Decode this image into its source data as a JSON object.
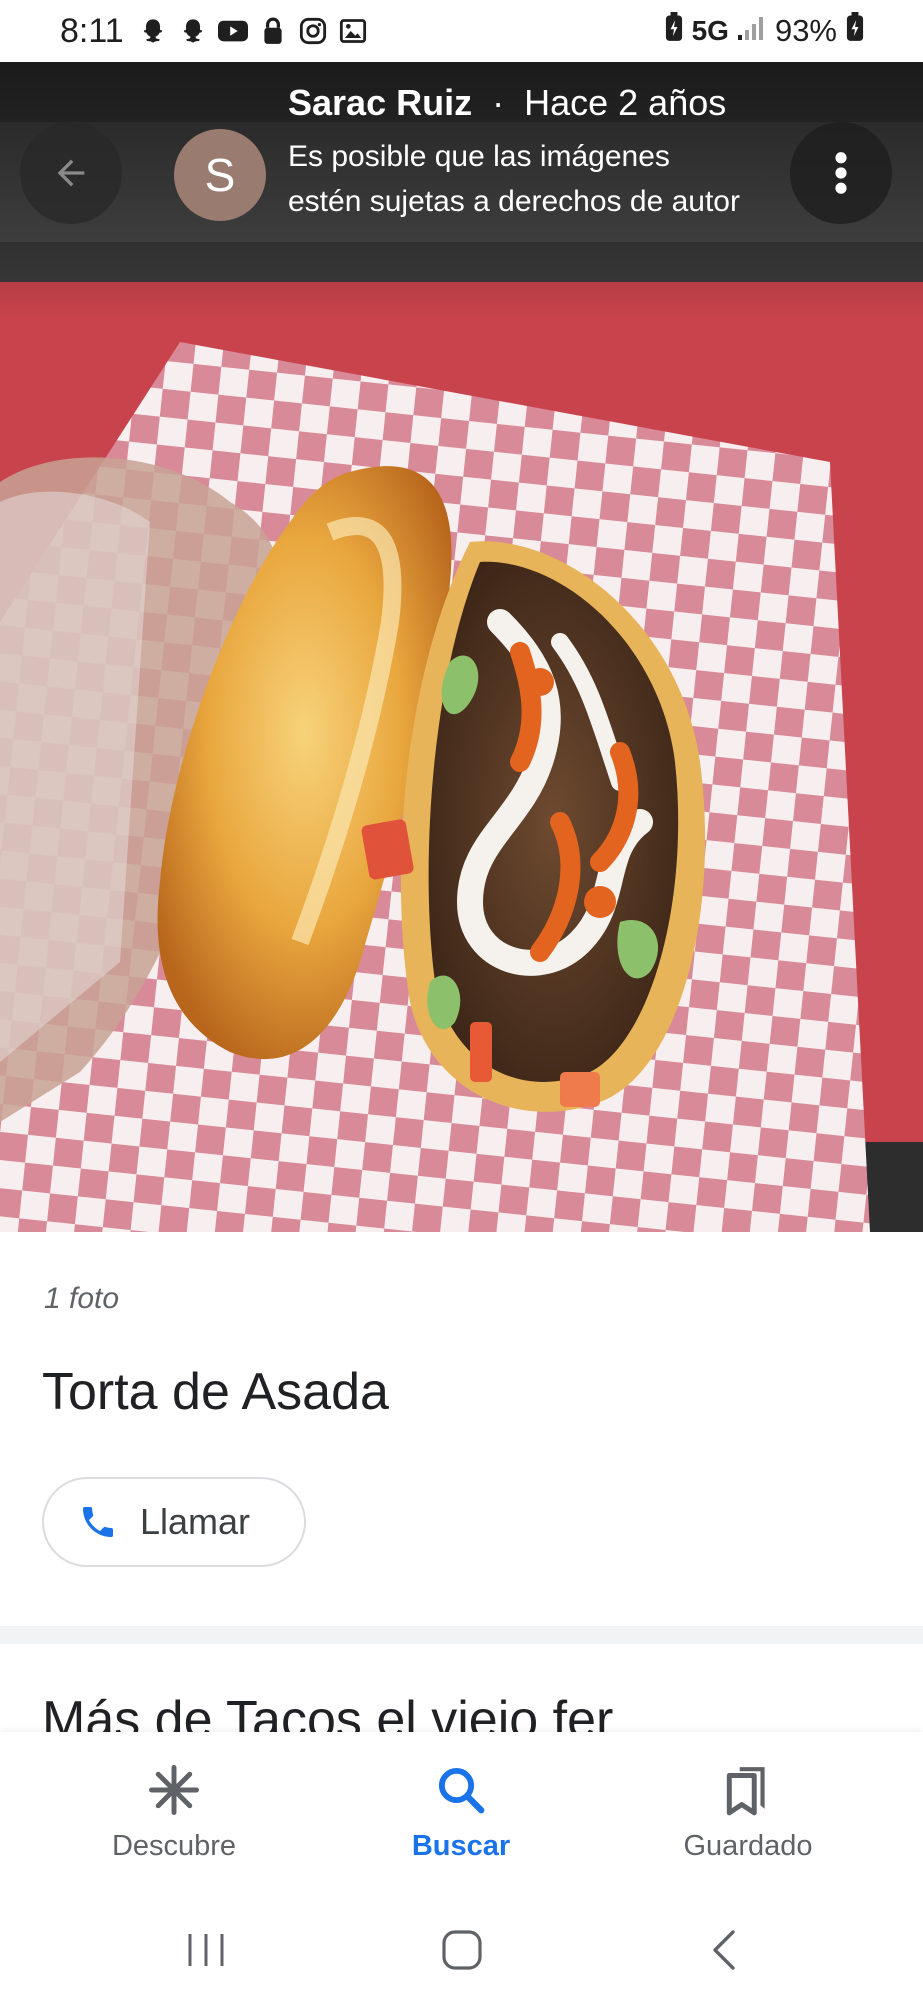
{
  "status_bar": {
    "time": "8:11",
    "network": "5G",
    "battery": "93%",
    "left_icons": [
      "snapchat-icon",
      "snapchat-icon",
      "youtube-icon",
      "lock-icon",
      "instagram-icon",
      "gallery-icon"
    ]
  },
  "photo": {
    "author": "Sarac Ruiz",
    "separator": "·",
    "time_ago": "Hace 2 años",
    "avatar_letter": "S",
    "copyright_notice": "Es posible que las imágenes estén sujetas a derechos de autor"
  },
  "info": {
    "photo_count": "1 foto",
    "title": "Torta de Asada",
    "call_label": "Llamar",
    "more_heading": "Más de Tacos el viejo fer"
  },
  "bottom_nav": {
    "items": [
      {
        "label": "Descubre",
        "icon": "asterisk-icon",
        "active": false
      },
      {
        "label": "Buscar",
        "icon": "search-icon",
        "active": true
      },
      {
        "label": "Guardado",
        "icon": "bookmarks-icon",
        "active": false
      }
    ]
  },
  "colors": {
    "accent": "#1a73e8",
    "avatar_bg": "#9a7b70",
    "text_primary": "#202124",
    "text_secondary": "#5f6368"
  }
}
